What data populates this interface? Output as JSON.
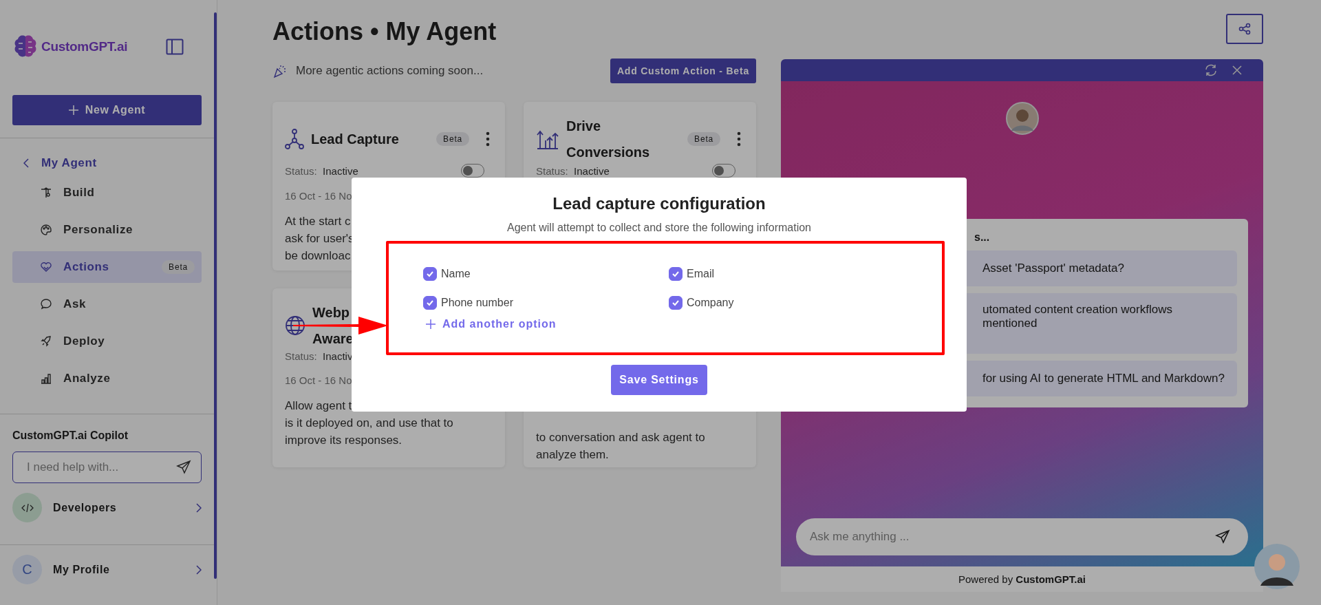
{
  "sidebar": {
    "logo_text": "CustomGPT.ai",
    "new_agent_button": "New Agent",
    "back_item": "My Agent",
    "items": [
      {
        "label": "Build",
        "selected": false
      },
      {
        "label": "Personalize",
        "selected": false
      },
      {
        "label": "Actions",
        "selected": true,
        "badge": "Beta"
      },
      {
        "label": "Ask",
        "selected": false
      },
      {
        "label": "Deploy",
        "selected": false
      },
      {
        "label": "Analyze",
        "selected": false
      }
    ],
    "copilot": {
      "title": "CustomGPT.ai Copilot",
      "placeholder": "I need help with..."
    },
    "developers": "Developers",
    "profile": {
      "initial": "C",
      "label": "My Profile"
    }
  },
  "main": {
    "title": "Actions • My Agent",
    "notice": "More agentic actions coming soon...",
    "add_button": "Add Custom Action - Beta",
    "cards": [
      {
        "title_lines": [
          "Lead Capture"
        ],
        "badge": "Beta",
        "status_label": "Status:",
        "status": "Inactive",
        "on": false,
        "date": "16 Oct - 16 No",
        "description": [
          "At the start c",
          "ask for user's",
          "be downloac"
        ]
      },
      {
        "title_lines": [
          "Drive",
          "Conversions"
        ],
        "badge": "Beta",
        "status_label": "Status:",
        "status": "Inactive",
        "on": false
      },
      {
        "title_lines": [
          "Webp",
          "Aware"
        ],
        "status_label": "Status:",
        "status": "Inactiv",
        "date": "16 Oct - 16 No",
        "description": [
          "Allow agent t",
          "is it deployed on, and use that to",
          "improve its responses."
        ]
      },
      {
        "description": [
          "to conversation and ask agent to",
          "analyze them."
        ]
      }
    ]
  },
  "chat": {
    "suggestions_heading": "s...",
    "suggestions": [
      "Asset 'Passport' metadata?",
      "utomated content creation workflows mentioned",
      "for using AI to generate HTML and Markdown?"
    ],
    "placeholder": "Ask me anything ...",
    "powered": "Powered by **CustomGPT.ai**"
  },
  "modal": {
    "title": "Lead capture configuration",
    "subtitle": "Agent will attempt to collect and store the following information",
    "fields": [
      {
        "label": "Name",
        "checked": true
      },
      {
        "label": "Email",
        "checked": true
      },
      {
        "label": "Phone number",
        "checked": true
      },
      {
        "label": "Company",
        "checked": true
      }
    ],
    "add_option": "Add another option",
    "save_button": "Save Settings"
  }
}
